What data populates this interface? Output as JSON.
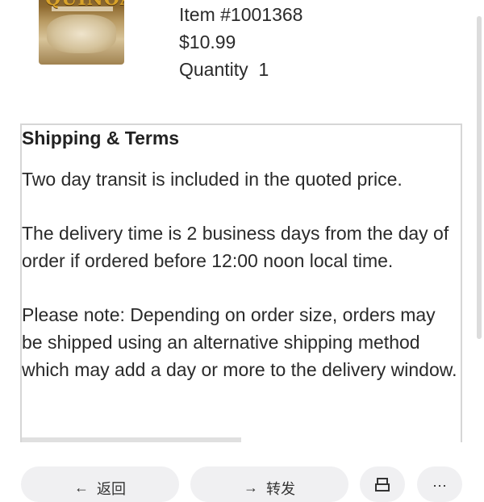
{
  "product": {
    "brand_text": "QUINOA",
    "item_number": "Item #1001368",
    "price": "$10.99",
    "quantity_label": "Quantity",
    "quantity_value": "1"
  },
  "terms": {
    "title": "Shipping & Terms",
    "paragraphs": [
      "Two day transit is included in the quoted price.",
      "The delivery time is 2 business days from the day of order if ordered before 12:00 noon local time.",
      "Please note: Depending on order size, orders may be shipped using an alternative shipping method which may add a day or more to the delivery window."
    ]
  },
  "bottom_bar": {
    "back_label": "返回",
    "back_icon": "left-arrow-icon",
    "forward_label": "转发",
    "forward_icon": "right-arrow-icon",
    "third_icon": "print-icon",
    "fourth_icon": "more-icon"
  }
}
